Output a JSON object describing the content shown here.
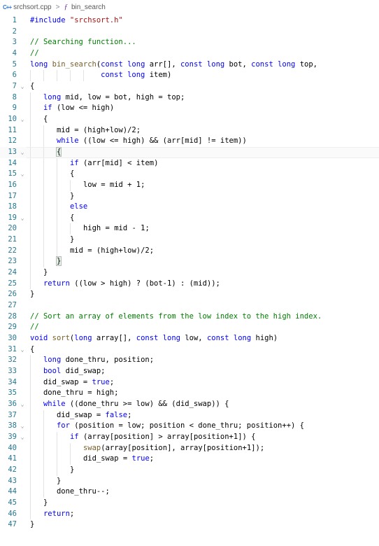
{
  "breadcrumb": {
    "file_icon": "C++",
    "file": "srchsort.cpp",
    "separator": ">",
    "symbol_icon": "ƒ",
    "symbol": "bin_search"
  },
  "editor": {
    "current_line": 13,
    "lines": [
      {
        "n": "1",
        "indent": 0,
        "fold": false,
        "text": "#include \"srchsort.h\""
      },
      {
        "n": "2",
        "indent": 0,
        "fold": false,
        "text": ""
      },
      {
        "n": "3",
        "indent": 0,
        "fold": false,
        "text": "// Searching function..."
      },
      {
        "n": "4",
        "indent": 0,
        "fold": false,
        "text": "//"
      },
      {
        "n": "5",
        "indent": 0,
        "fold": false,
        "text": "long bin_search(const long arr[], const long bot, const long top,"
      },
      {
        "n": "6",
        "indent": 0,
        "fold": false,
        "text": "                const long item)"
      },
      {
        "n": "7",
        "indent": 0,
        "fold": true,
        "text": "{"
      },
      {
        "n": "8",
        "indent": 1,
        "fold": false,
        "text": "long mid, low = bot, high = top;"
      },
      {
        "n": "9",
        "indent": 1,
        "fold": false,
        "text": "if (low <= high)"
      },
      {
        "n": "10",
        "indent": 1,
        "fold": true,
        "text": "{"
      },
      {
        "n": "11",
        "indent": 2,
        "fold": false,
        "text": "mid = (high+low)/2;"
      },
      {
        "n": "12",
        "indent": 2,
        "fold": false,
        "text": "while ((low <= high) && (arr[mid] != item))"
      },
      {
        "n": "13",
        "indent": 2,
        "fold": true,
        "text": "{"
      },
      {
        "n": "14",
        "indent": 3,
        "fold": false,
        "text": "if (arr[mid] < item)"
      },
      {
        "n": "15",
        "indent": 3,
        "fold": true,
        "text": "{"
      },
      {
        "n": "16",
        "indent": 4,
        "fold": false,
        "text": "low = mid + 1;"
      },
      {
        "n": "17",
        "indent": 3,
        "fold": false,
        "text": "}"
      },
      {
        "n": "18",
        "indent": 3,
        "fold": false,
        "text": "else"
      },
      {
        "n": "19",
        "indent": 3,
        "fold": true,
        "text": "{"
      },
      {
        "n": "20",
        "indent": 4,
        "fold": false,
        "text": "high = mid - 1;"
      },
      {
        "n": "21",
        "indent": 3,
        "fold": false,
        "text": "}"
      },
      {
        "n": "22",
        "indent": 3,
        "fold": false,
        "text": "mid = (high+low)/2;"
      },
      {
        "n": "23",
        "indent": 2,
        "fold": false,
        "text": "}"
      },
      {
        "n": "24",
        "indent": 1,
        "fold": false,
        "text": "}"
      },
      {
        "n": "25",
        "indent": 1,
        "fold": false,
        "text": "return ((low > high) ? (bot-1) : (mid));"
      },
      {
        "n": "26",
        "indent": 0,
        "fold": false,
        "text": "}"
      },
      {
        "n": "27",
        "indent": 0,
        "fold": false,
        "text": ""
      },
      {
        "n": "28",
        "indent": 0,
        "fold": false,
        "text": "// Sort an array of elements from the low index to the high index."
      },
      {
        "n": "29",
        "indent": 0,
        "fold": false,
        "text": "//"
      },
      {
        "n": "30",
        "indent": 0,
        "fold": false,
        "text": "void sort(long array[], const long low, const long high)"
      },
      {
        "n": "31",
        "indent": 0,
        "fold": true,
        "text": "{"
      },
      {
        "n": "32",
        "indent": 1,
        "fold": false,
        "text": "long done_thru, position;"
      },
      {
        "n": "33",
        "indent": 1,
        "fold": false,
        "text": "bool did_swap;"
      },
      {
        "n": "34",
        "indent": 1,
        "fold": false,
        "text": "did_swap = true;"
      },
      {
        "n": "35",
        "indent": 1,
        "fold": false,
        "text": "done_thru = high;"
      },
      {
        "n": "36",
        "indent": 1,
        "fold": true,
        "text": "while ((done_thru >= low) && (did_swap)) {"
      },
      {
        "n": "37",
        "indent": 2,
        "fold": false,
        "text": "did_swap = false;"
      },
      {
        "n": "38",
        "indent": 2,
        "fold": true,
        "text": "for (position = low; position < done_thru; position++) {"
      },
      {
        "n": "39",
        "indent": 3,
        "fold": true,
        "text": "if (array[position] > array[position+1]) {"
      },
      {
        "n": "40",
        "indent": 4,
        "fold": false,
        "text": "swap(array[position], array[position+1]);"
      },
      {
        "n": "41",
        "indent": 4,
        "fold": false,
        "text": "did_swap = true;"
      },
      {
        "n": "42",
        "indent": 3,
        "fold": false,
        "text": "}"
      },
      {
        "n": "43",
        "indent": 2,
        "fold": false,
        "text": "}"
      },
      {
        "n": "44",
        "indent": 2,
        "fold": false,
        "text": "done_thru--;"
      },
      {
        "n": "45",
        "indent": 1,
        "fold": false,
        "text": "}"
      },
      {
        "n": "46",
        "indent": 1,
        "fold": false,
        "text": "return;"
      },
      {
        "n": "47",
        "indent": 0,
        "fold": false,
        "text": "}"
      }
    ]
  },
  "icons": {
    "fold": "chevron-down-icon",
    "file": "cpp-file-icon",
    "symbol": "function-icon"
  },
  "colors": {
    "keyword": "#0000ff",
    "comment": "#008000",
    "string": "#a31515",
    "number": "#098658",
    "function": "#795e26",
    "line_number": "#237893",
    "indent_guide": "#e3e3e3"
  }
}
